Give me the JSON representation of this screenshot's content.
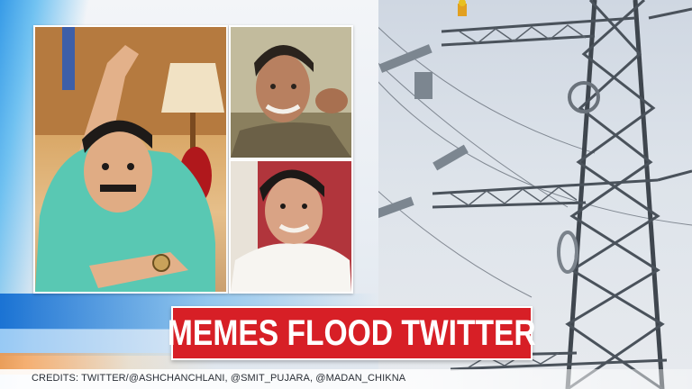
{
  "headline": "MEMES FLOOD TWITTER",
  "credits": "CREDITS: TWITTER/@ASHCHANCHLANI, @SMIT_PUJARA, @MADAN_CHIKNA",
  "colors": {
    "headline_bg": "#d71f26",
    "headline_text": "#ffffff",
    "accent_blue": "#1e78d2"
  }
}
